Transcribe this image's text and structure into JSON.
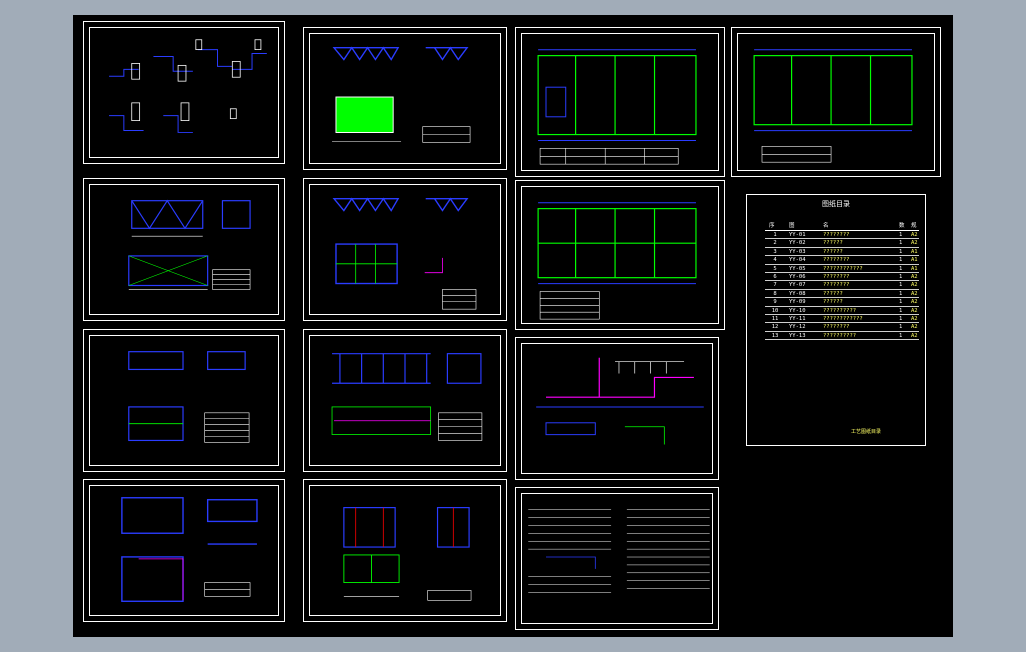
{
  "index": {
    "title": "图纸目录",
    "headers": [
      "序",
      "图",
      "名",
      "数",
      "规"
    ],
    "rows": [
      {
        "no": "1",
        "code": "YY-01",
        "name": "????????",
        "qty": "1",
        "size": "A2"
      },
      {
        "no": "2",
        "code": "YY-02",
        "name": "??????",
        "qty": "1",
        "size": "A2"
      },
      {
        "no": "3",
        "code": "YY-03",
        "name": "??????",
        "qty": "1",
        "size": "A1"
      },
      {
        "no": "4",
        "code": "YY-04",
        "name": "????????",
        "qty": "1",
        "size": "A1"
      },
      {
        "no": "5",
        "code": "YY-05",
        "name": "????????????",
        "qty": "1",
        "size": "A1"
      },
      {
        "no": "6",
        "code": "YY-06",
        "name": "????????",
        "qty": "1",
        "size": "A2"
      },
      {
        "no": "7",
        "code": "YY-07",
        "name": "????????",
        "qty": "1",
        "size": "A2"
      },
      {
        "no": "8",
        "code": "YY-08",
        "name": "??????",
        "qty": "1",
        "size": "A2"
      },
      {
        "no": "9",
        "code": "YY-09",
        "name": "??????",
        "qty": "1",
        "size": "A2"
      },
      {
        "no": "10",
        "code": "YY-10",
        "name": "??????????",
        "qty": "1",
        "size": "A2"
      },
      {
        "no": "11",
        "code": "YY-11",
        "name": "????????????",
        "qty": "1",
        "size": "A2"
      },
      {
        "no": "12",
        "code": "YY-12",
        "name": "????????",
        "qty": "1",
        "size": "A2"
      },
      {
        "no": "13",
        "code": "YY-13",
        "name": "??????????",
        "qty": "1",
        "size": "A2"
      }
    ],
    "titleblock_label": "工艺图纸目录"
  },
  "colors": {
    "background": "#a1acb8",
    "canvas": "#000000",
    "frame": "#ffffff",
    "blue": "#2a3cff",
    "green": "#00ff00",
    "magenta": "#ff00ff",
    "yellow": "#ffff66"
  }
}
